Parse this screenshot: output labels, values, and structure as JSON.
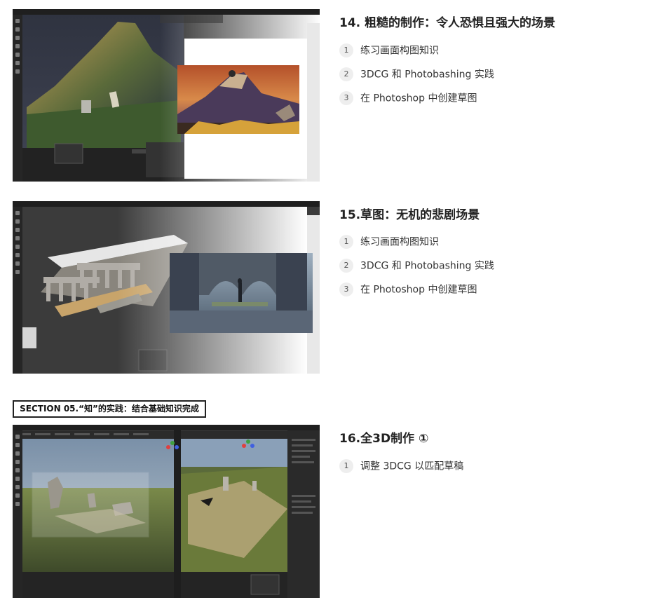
{
  "sections": [
    {
      "title": "14. 粗糙的制作：令人恐惧且强大的场景",
      "thumb_label": "3D mountain scene and Photoshop painted mountain",
      "items": [
        {
          "num": "1",
          "text": "练习画面构图知识"
        },
        {
          "num": "2",
          "text": "3DCG 和 Photobashing 实践"
        },
        {
          "num": "3",
          "text": "在 Photoshop 中创建草图"
        }
      ]
    },
    {
      "title": "15.草图：无机的悲剧场景",
      "thumb_label": "3D arches model and Photoshop painted ruins",
      "items": [
        {
          "num": "1",
          "text": "练习画面构图知识"
        },
        {
          "num": "2",
          "text": "3DCG 和 Photobashing 实践"
        },
        {
          "num": "3",
          "text": "在 Photoshop 中创建草图"
        }
      ]
    },
    {
      "title": "16.全3D制作 ①",
      "thumb_label": "Full 3D grassland ruins scene in Blender",
      "items": [
        {
          "num": "1",
          "text": "调整 3DCG 以匹配草稿"
        }
      ]
    }
  ],
  "section_header": "SECTION 05.“知”的实践：结合基础知识完成",
  "colors": {
    "accent": "#222222",
    "badge_bg": "#eeeeee"
  }
}
